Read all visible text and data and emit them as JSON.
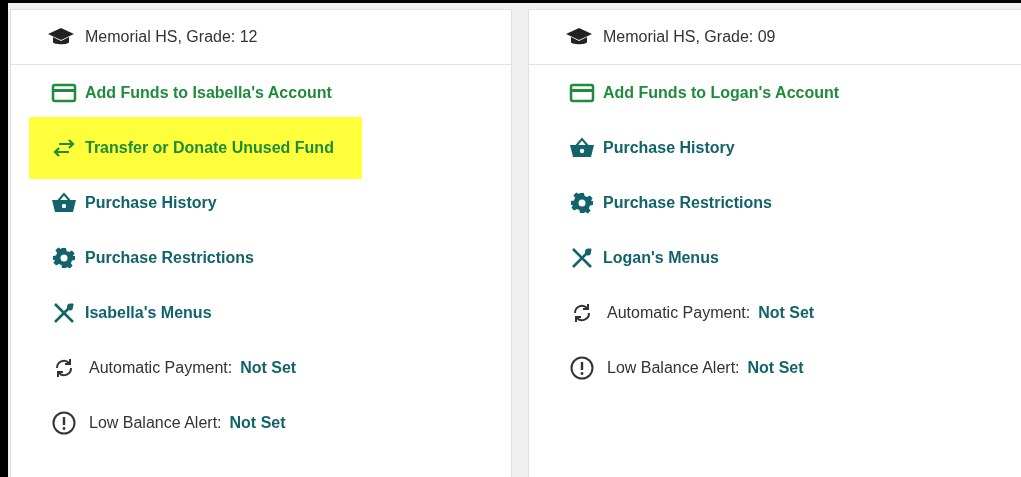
{
  "cards": [
    {
      "header": "Memorial HS, Grade: 12",
      "items": [
        {
          "kind": "add-funds",
          "label": "Add Funds to Isabella's Account",
          "highlighted": false
        },
        {
          "kind": "transfer",
          "label": "Transfer or Donate Unused Fund",
          "highlighted": true
        },
        {
          "kind": "history",
          "label": "Purchase History",
          "highlighted": false
        },
        {
          "kind": "restrictions",
          "label": "Purchase Restrictions",
          "highlighted": false
        },
        {
          "kind": "menus",
          "label": "Isabella's Menus",
          "highlighted": false
        },
        {
          "kind": "autopay",
          "label": "Automatic Payment:",
          "value": "Not Set",
          "highlighted": false
        },
        {
          "kind": "alert",
          "label": "Low Balance Alert:",
          "value": "Not Set",
          "highlighted": false
        }
      ]
    },
    {
      "header": "Memorial HS, Grade: 09",
      "items": [
        {
          "kind": "add-funds",
          "label": "Add Funds to Logan's Account",
          "highlighted": false
        },
        {
          "kind": "history",
          "label": "Purchase History",
          "highlighted": false
        },
        {
          "kind": "restrictions",
          "label": "Purchase Restrictions",
          "highlighted": false
        },
        {
          "kind": "menus",
          "label": "Logan's Menus",
          "highlighted": false
        },
        {
          "kind": "autopay",
          "label": "Automatic Payment:",
          "value": "Not Set",
          "highlighted": false
        },
        {
          "kind": "alert",
          "label": "Low Balance Alert:",
          "value": "Not Set",
          "highlighted": false
        }
      ]
    }
  ]
}
